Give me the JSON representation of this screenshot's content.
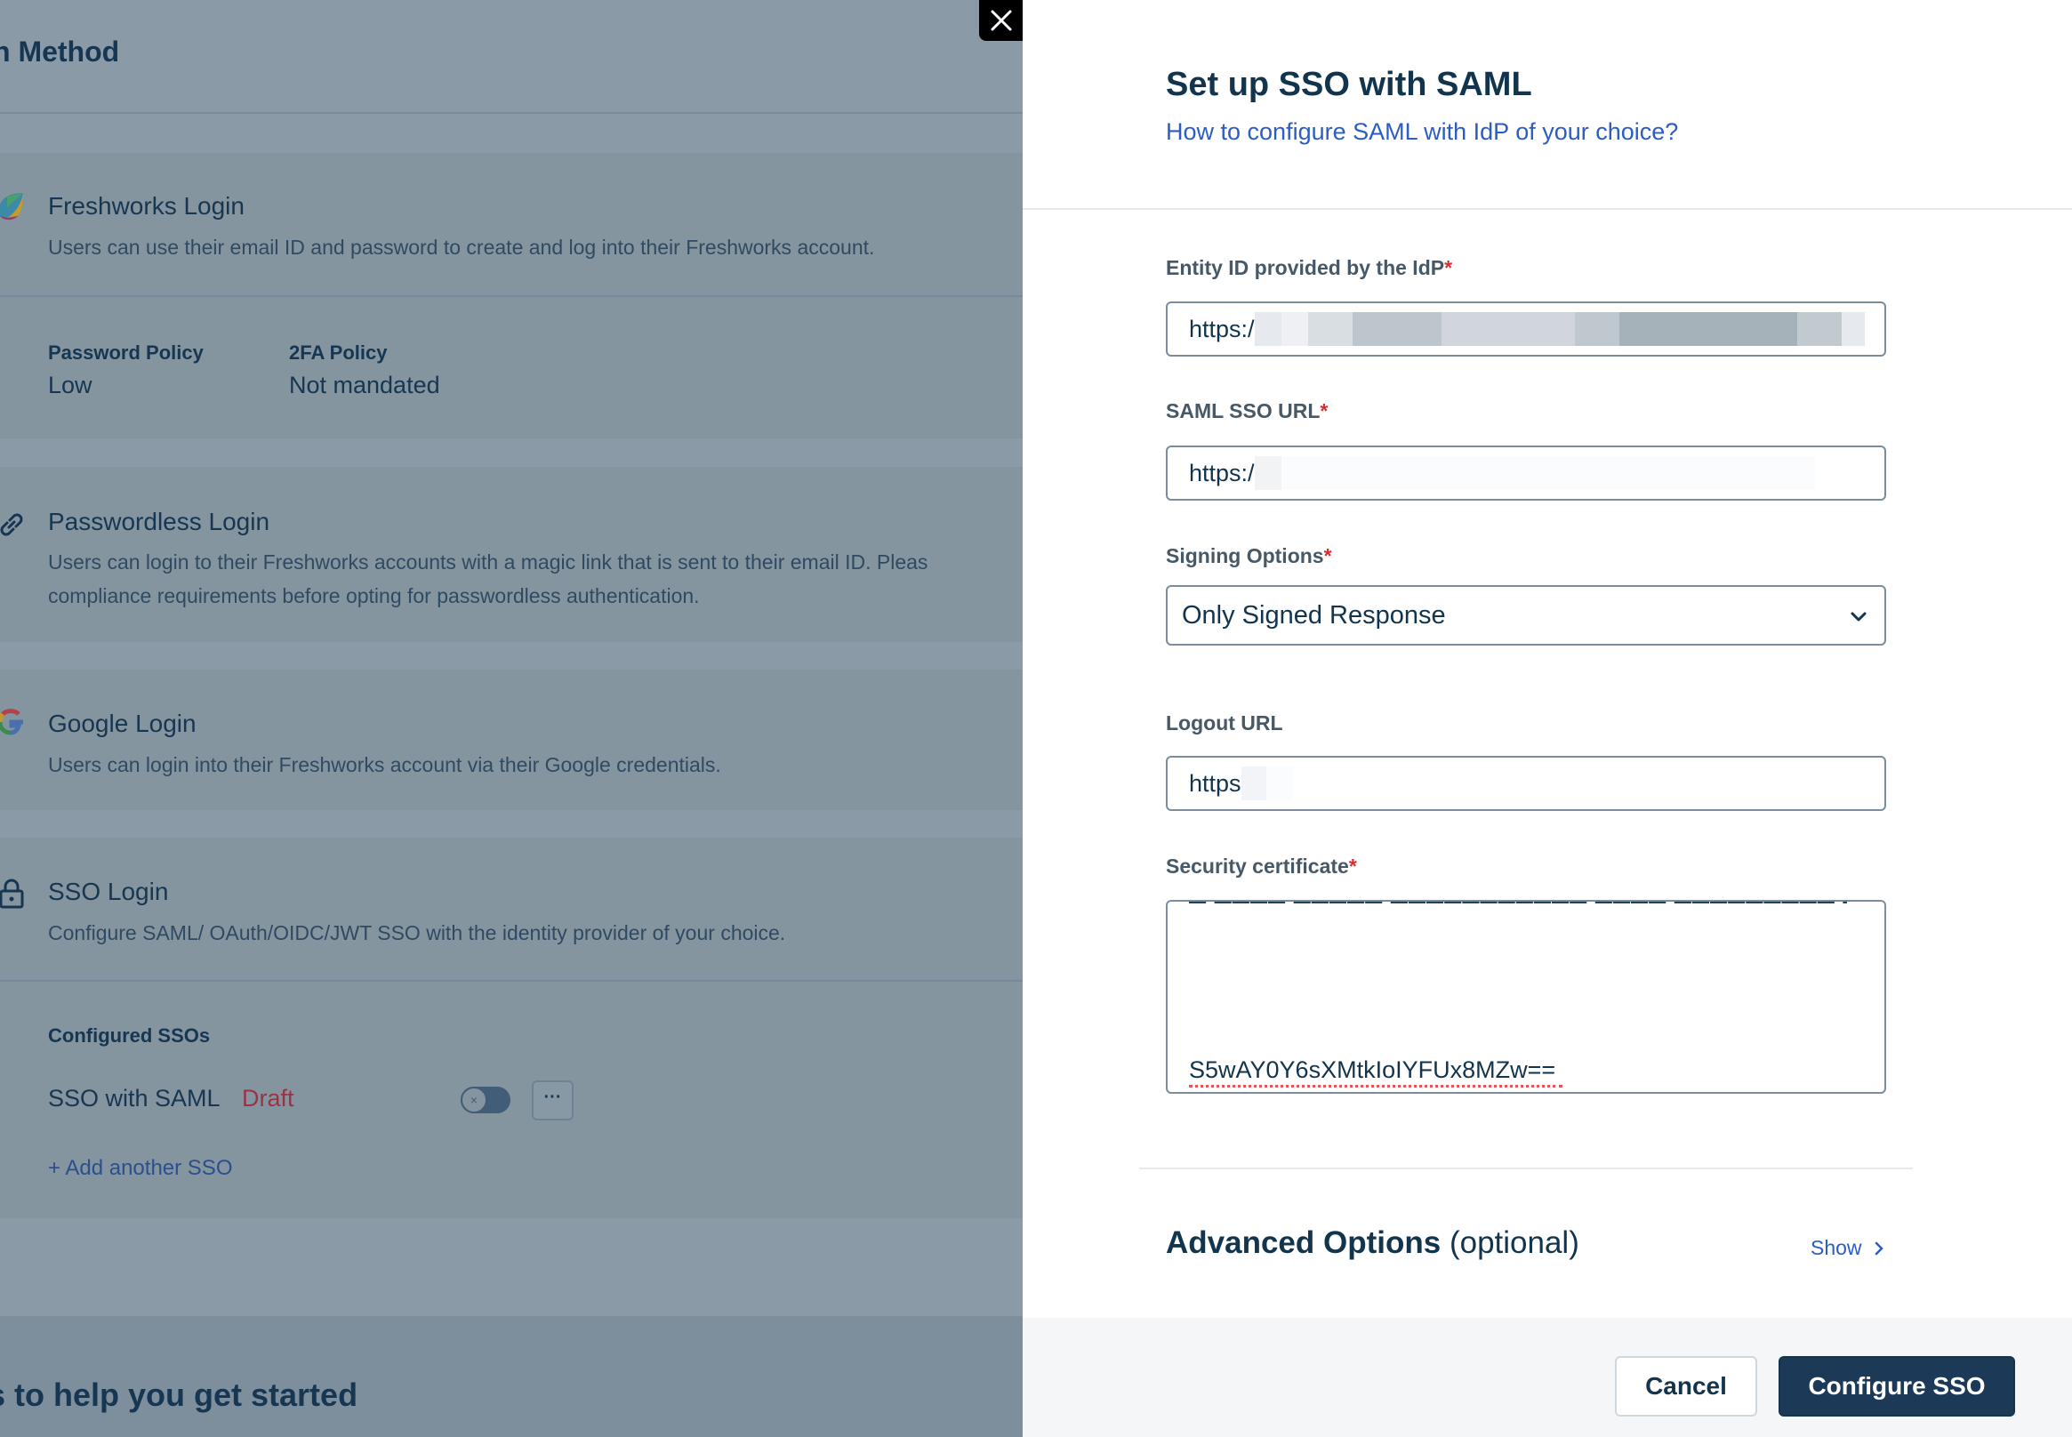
{
  "background_page": {
    "title": "n Method",
    "freshworks_login": {
      "title": "Freshworks Login",
      "description": "Users can use their email ID and password to create and log into their Freshworks account.",
      "icon": "freshworks-logo-icon"
    },
    "policies": [
      {
        "label": "Password Policy",
        "value": "Low"
      },
      {
        "label": "2FA Policy",
        "value": "Not mandated"
      }
    ],
    "passwordless_login": {
      "title": "Passwordless Login",
      "description_line1": "Users can login to their Freshworks accounts with a magic link that is sent to their email ID. Pleas",
      "description_line2": "compliance requirements before opting for passwordless authentication.",
      "icon": "link-icon"
    },
    "google_login": {
      "title": "Google Login",
      "description": "Users can login into their Freshworks account via their Google credentials.",
      "icon": "google-icon"
    },
    "sso_login": {
      "title": "SSO Login",
      "description": "Configure SAML/ OAuth/OIDC/JWT SSO with the identity provider of your choice.",
      "icon": "lock-icon"
    },
    "configured_ssos": {
      "label": "Configured SSOs",
      "items": [
        {
          "name": "SSO with SAML",
          "status": "Draft",
          "enabled": false,
          "more_label": "···"
        }
      ],
      "add_label": "+ Add another SSO"
    },
    "bottom_heading": "s to help you get started"
  },
  "panel": {
    "close_icon": "close-icon",
    "title": "Set up SSO with SAML",
    "help_link": "How to configure SAML with IdP of your choice?",
    "fields": {
      "entity_id": {
        "label": "Entity ID provided by the IdP",
        "required_mark": "*",
        "value_prefix": "https:/",
        "redacted": true
      },
      "saml_sso_url": {
        "label": "SAML SSO URL",
        "required_mark": "*",
        "value_prefix": "https:/",
        "redacted": true
      },
      "signing_options": {
        "label": "Signing Options",
        "required_mark": "*",
        "selected": "Only Signed Response"
      },
      "logout_url": {
        "label": "Logout URL",
        "value_prefix": "https",
        "redacted": true
      },
      "security_certificate": {
        "label": "Security certificate",
        "required_mark": "*",
        "value_last_line": "S5wAY0Y6sXMtkIoIYFUx8MZw=="
      }
    },
    "advanced": {
      "title": "Advanced Options",
      "optional": "(optional)",
      "toggle_label": "Show"
    },
    "footer": {
      "cancel_label": "Cancel",
      "submit_label": "Configure SSO"
    }
  },
  "annotation": {
    "type": "arrow",
    "color": "#d93a3a",
    "points_to": "security-certificate-textarea"
  },
  "colors": {
    "overlay": "#8a9aa6",
    "primary": "#1c3a57",
    "link": "#2c5cc5",
    "required": "#d72d30",
    "draft": "#9a3345"
  }
}
